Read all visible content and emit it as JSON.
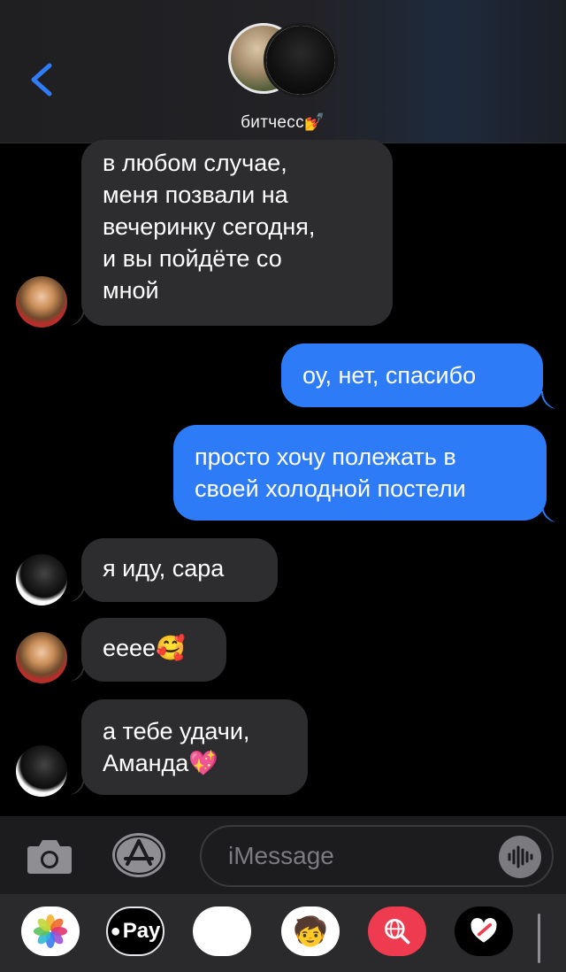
{
  "header": {
    "group_name": "битчесс💅",
    "back_icon": "chevron-left-icon"
  },
  "messages": [
    {
      "from": "girl",
      "direction": "incoming",
      "text": [
        "в любом случае,",
        "меня позвали на",
        "вечеринку сегодня,",
        "и вы пойдёте со",
        "мной"
      ]
    },
    {
      "from": "me",
      "direction": "outgoing",
      "text": [
        "оу, нет, спасибо"
      ]
    },
    {
      "from": "me",
      "direction": "outgoing",
      "text": [
        "просто хочу полежать в",
        "своей холодной постели"
      ]
    },
    {
      "from": "boy",
      "direction": "incoming",
      "text": [
        "я иду, сара"
      ]
    },
    {
      "from": "girl",
      "direction": "incoming",
      "text": [
        "eeee🥰"
      ]
    },
    {
      "from": "boy",
      "direction": "incoming",
      "text": [
        "а тебе удачи,",
        "Аманда💖"
      ]
    }
  ],
  "input_bar": {
    "placeholder": "iMessage",
    "camera_icon": "camera-icon",
    "apps_icon": "app-store-icon",
    "audio_icon": "audio-waveform-icon"
  },
  "app_drawer": {
    "apps": [
      {
        "name": "photos-app-icon"
      },
      {
        "name": "apple-pay-app-icon",
        "label": "Pay"
      },
      {
        "name": "animoji-app-icon",
        "emoji": "🐵"
      },
      {
        "name": "memoji-stickers-app-icon",
        "emoji": "🧒"
      },
      {
        "name": "web-search-app-icon"
      },
      {
        "name": "digital-touch-app-icon"
      }
    ]
  },
  "colors": {
    "incoming_bubble": "#2d2d2f",
    "outgoing_bubble": "#2d7bf6",
    "accent": "#2f7cf6"
  }
}
